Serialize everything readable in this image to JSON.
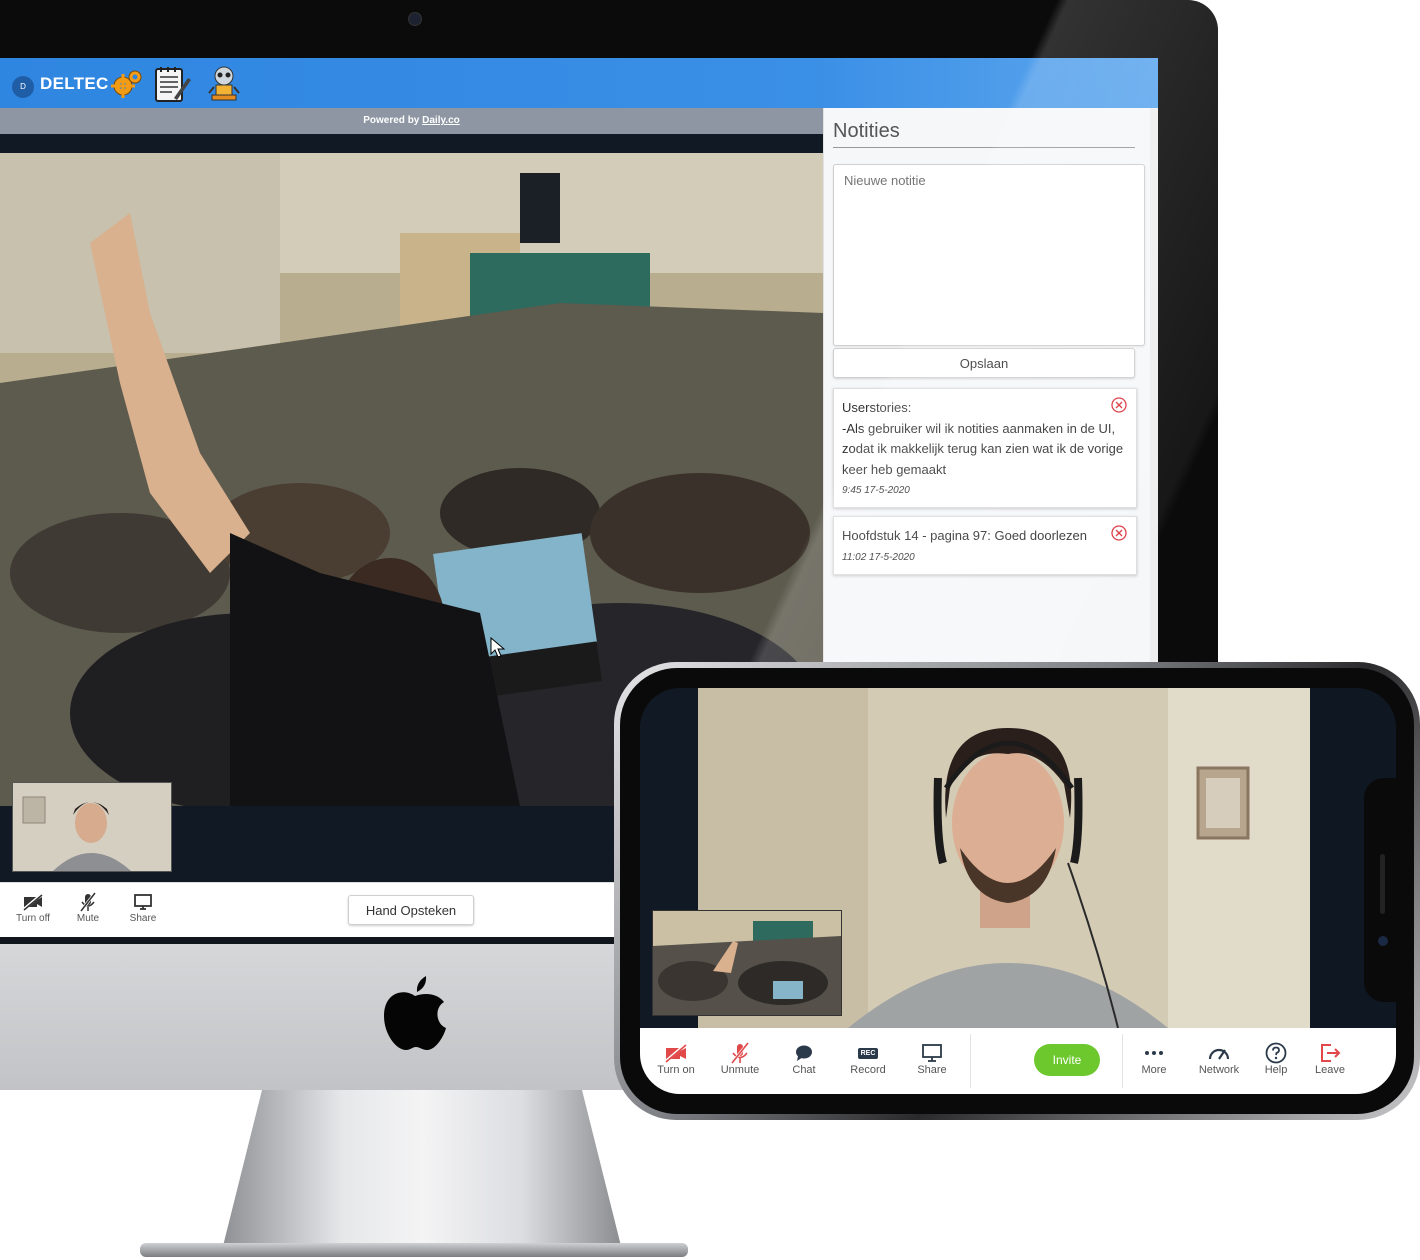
{
  "app": {
    "brand_mark": "D",
    "brand_name": "DELTEC",
    "toolbar_icons": [
      "gear-icon",
      "notepad-icon",
      "robot-icon"
    ],
    "powered_by_prefix": "Powered by ",
    "powered_by_link": "Daily.co"
  },
  "desktop_controls": {
    "turn_off": "Turn off",
    "mute": "Mute",
    "share": "Share",
    "hand_button": "Hand Opsteken"
  },
  "notes": {
    "title": "Notities",
    "placeholder": "Nieuwe notitie",
    "save_label": "Opslaan",
    "items": [
      {
        "text": "Userstories:\n-Als gebruiker wil ik notities aanmaken in de UI, zodat ik makkelijk terug kan zien wat ik de vorige keer heb gemaakt",
        "timestamp": "9:45 17-5-2020"
      },
      {
        "text": "Hoofdstuk 14 - pagina 97: Goed doorlezen",
        "timestamp": "11:02 17-5-2020"
      }
    ]
  },
  "phone_tray": {
    "turn_on": "Turn on",
    "unmute": "Unmute",
    "chat": "Chat",
    "record": "Record",
    "record_badge": "REC",
    "share": "Share",
    "invite": "Invite",
    "more": "More",
    "network": "Network",
    "help": "Help",
    "leave": "Leave"
  },
  "colors": {
    "topbar": "#2f86e0",
    "invite": "#6cc82c",
    "muted_red": "#e0484a",
    "delete_red": "#d9363e"
  }
}
